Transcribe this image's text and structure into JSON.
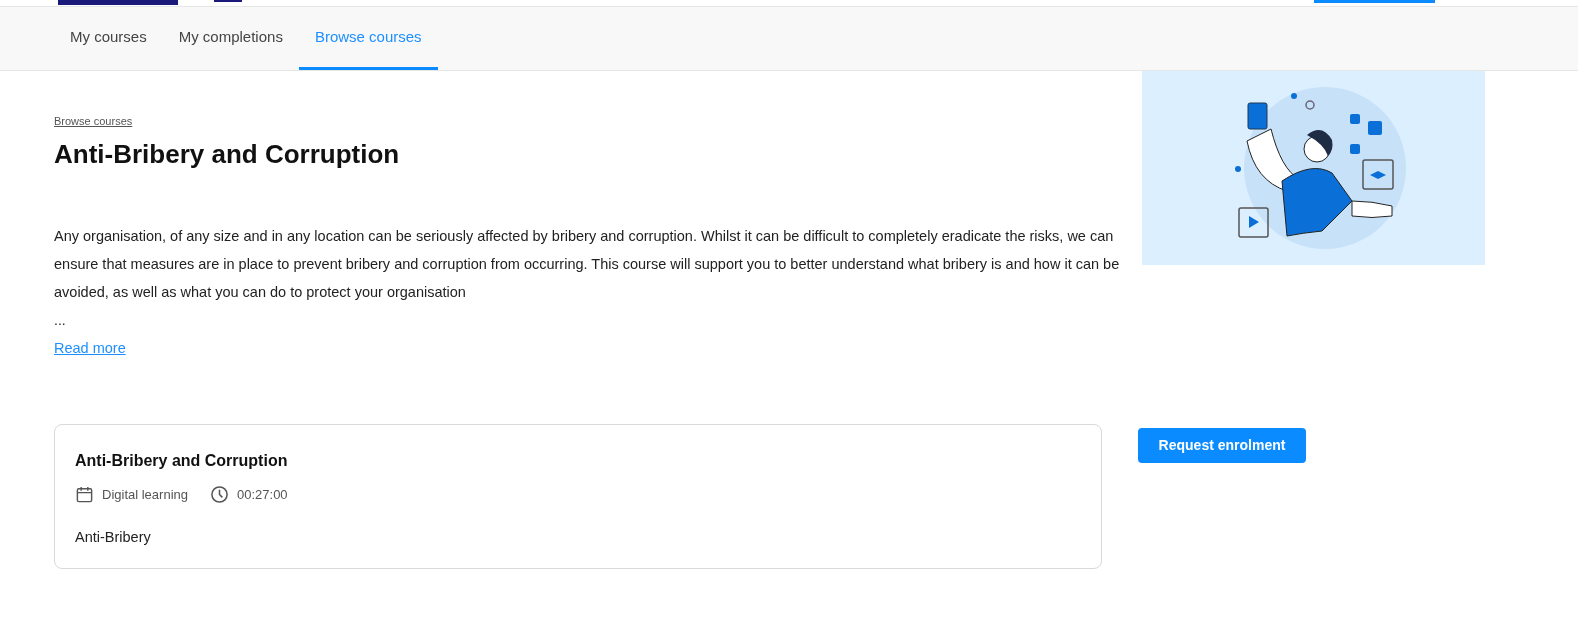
{
  "tabs": [
    {
      "label": "My courses",
      "selected": false
    },
    {
      "label": "My completions",
      "selected": false
    },
    {
      "label": "Browse courses",
      "selected": true
    }
  ],
  "breadcrumb": "Browse courses",
  "title": "Anti-Bribery and Corruption",
  "description": "Any organisation, of any size and in any location can be seriously affected by bribery and corruption. Whilst it can be difficult to completely eradicate the risks, we can ensure that measures are in place to prevent bribery and corruption from occurring. This course will support you to better understand what bribery is and how it can be avoided, as well as what you can do to protect your organisation",
  "ellipsis": "...",
  "read_more": "Read more",
  "course_card": {
    "title": "Anti-Bribery and Corruption",
    "format": "Digital learning",
    "duration": "00:27:00",
    "summary": "Anti-Bribery"
  },
  "request_button": "Request enrolment"
}
